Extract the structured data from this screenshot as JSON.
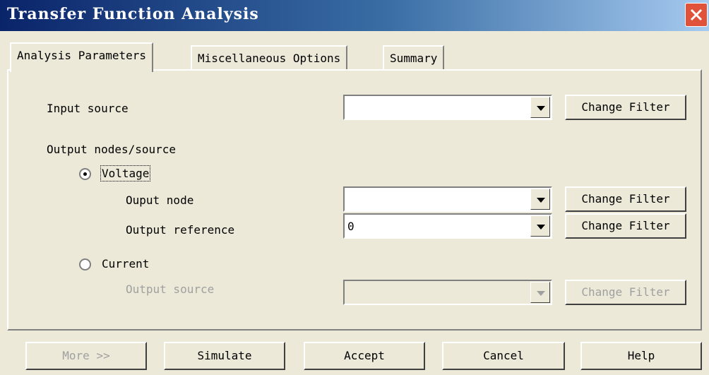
{
  "window": {
    "title": "Transfer Function Analysis",
    "close_icon": "close-icon"
  },
  "tabs": [
    {
      "label": "Analysis Parameters",
      "active": true
    },
    {
      "label": "Miscellaneous Options",
      "active": false
    },
    {
      "label": "Summary",
      "active": false
    }
  ],
  "form": {
    "input_source": {
      "label": "Input source",
      "value": "",
      "filter_label": "Change Filter"
    },
    "output_group_label": "Output nodes/source",
    "voltage": {
      "label": "Voltage",
      "selected": true
    },
    "output_node": {
      "label": "Ouput node",
      "value": "",
      "filter_label": "Change Filter"
    },
    "output_reference": {
      "label": "Output reference",
      "value": "0",
      "filter_label": "Change Filter"
    },
    "current": {
      "label": "Current",
      "selected": false
    },
    "output_source": {
      "label": "Output source",
      "value": "",
      "filter_label": "Change Filter",
      "disabled": true
    }
  },
  "buttons": {
    "more": "More >>",
    "simulate": "Simulate",
    "accept": "Accept",
    "cancel": "Cancel",
    "help": "Help"
  },
  "colors": {
    "title_bar": "#0a246a",
    "close_button": "#e0523a",
    "dialog_bg": "#ece9d8"
  }
}
